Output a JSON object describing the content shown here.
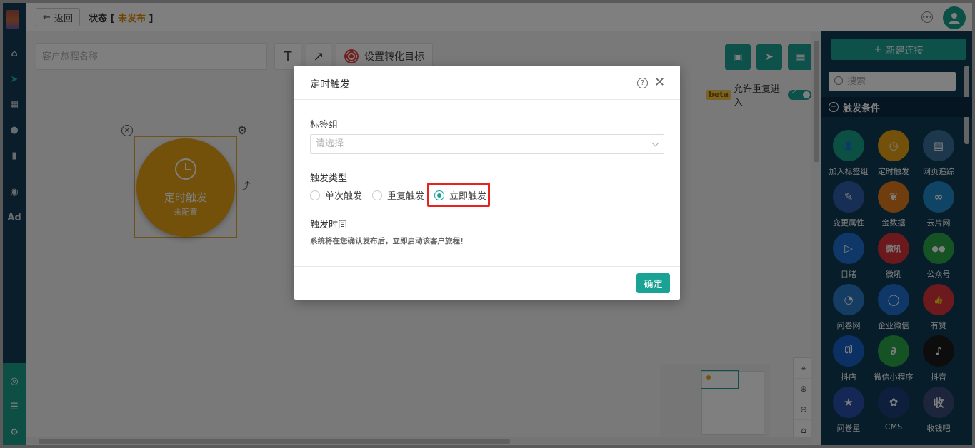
{
  "header": {
    "back_label": "返回",
    "status_label": "状态 [",
    "status_value": "未发布",
    "status_end": "]"
  },
  "toolbar": {
    "name_placeholder": "客户旅程名称",
    "text_tool": "T",
    "arrow_tool": "↗",
    "target_label": "设置转化目标"
  },
  "options": {
    "beta_badge": "beta",
    "reenter_label": "允许重复进入",
    "reenter_enabled": true
  },
  "node": {
    "title": "定时触发",
    "subtitle": "未配置"
  },
  "left_nav": {
    "ad_label": "Ad"
  },
  "right_panel": {
    "new_connection": "新建连接",
    "search_placeholder": "搜索",
    "section_title": "触发条件",
    "tiles": [
      {
        "label": "加入标签组",
        "icon": "user-add-icon",
        "color": "#16a085",
        "glyph": "👤"
      },
      {
        "label": "定时触发",
        "icon": "clock-icon",
        "color": "#e6a216",
        "glyph": "◷"
      },
      {
        "label": "网页追踪",
        "icon": "webpage-icon",
        "color": "#3b6f9a",
        "glyph": "▤"
      },
      {
        "label": "变更属性",
        "icon": "edit-icon",
        "color": "#2e5fa8",
        "glyph": "✎"
      },
      {
        "label": "金数据",
        "icon": "jinshuju-icon",
        "color": "#e07a1f",
        "glyph": "❦"
      },
      {
        "label": "云片网",
        "icon": "yunpian-icon",
        "color": "#1e88c8",
        "glyph": "∞"
      },
      {
        "label": "目睹",
        "icon": "play-icon",
        "color": "#1f6fd1",
        "glyph": "▷"
      },
      {
        "label": "微吼",
        "icon": "vhall-icon",
        "color": "#d6323a",
        "glyph": "微吼"
      },
      {
        "label": "公众号",
        "icon": "wechat-icon",
        "color": "#2aa748",
        "glyph": "●●"
      },
      {
        "label": "问卷网",
        "icon": "wenjuan-icon",
        "color": "#2a7bc8",
        "glyph": "◔"
      },
      {
        "label": "企业微信",
        "icon": "wecom-icon",
        "color": "#1e6fd0",
        "glyph": "◯"
      },
      {
        "label": "有赞",
        "icon": "youzan-icon",
        "color": "#d8343a",
        "glyph": "👍"
      },
      {
        "label": "抖店",
        "icon": "doudian-icon",
        "color": "#1763c9",
        "glyph": "៧"
      },
      {
        "label": "微信小程序",
        "icon": "miniprogram-icon",
        "color": "#2aa748",
        "glyph": "∂"
      },
      {
        "label": "抖音",
        "icon": "douyin-icon",
        "color": "#1a1a1a",
        "glyph": "♪"
      },
      {
        "label": "问卷星",
        "icon": "wjx-icon",
        "color": "#2b4fa8",
        "glyph": "★"
      },
      {
        "label": "CMS",
        "icon": "cms-icon",
        "color": "#1a3f7a",
        "glyph": "✿"
      },
      {
        "label": "收钱吧",
        "icon": "shouqianba-icon",
        "color": "#3a4a7a",
        "glyph": "收"
      }
    ]
  },
  "dialog": {
    "title": "定时触发",
    "tag_group_label": "标签组",
    "tag_group_placeholder": "请选择",
    "trigger_type_label": "触发类型",
    "trigger_options": [
      "单次触发",
      "重复触发",
      "立即触发"
    ],
    "selected_trigger": "立即触发",
    "trigger_time_label": "触发时间",
    "trigger_time_hint": "系统将在您确认发布后，立即启动该客户旅程！",
    "confirm_label": "确定"
  },
  "zoom_controls": [
    "⌖",
    "⊕",
    "⊖",
    "⌂"
  ],
  "colors": {
    "accent": "#1aa394",
    "nav_bg": "#123b55",
    "node": "#e6a216",
    "highlight": "#e8231f"
  }
}
